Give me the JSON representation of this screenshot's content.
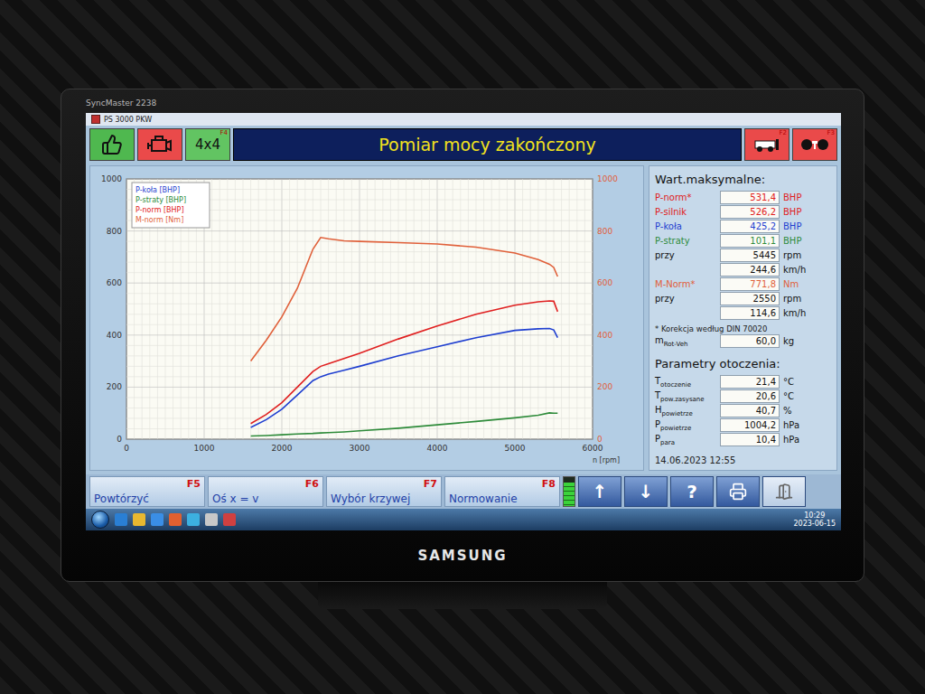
{
  "monitor": {
    "model": "SyncMaster 2238",
    "brand": "SAMSUNG"
  },
  "window": {
    "title": "PS 3000 PKW"
  },
  "header": {
    "drive": {
      "label": "4x4",
      "key": "F4"
    },
    "title": "Pomiar mocy zakończony",
    "vehicle_key": "F2",
    "roller_key": "F3"
  },
  "chart": {
    "x_label": "n [rpm]",
    "x_ticks": [
      "0",
      "1000",
      "2000",
      "3000",
      "4000",
      "5000",
      "6000"
    ],
    "y_ticks": [
      "0",
      "200",
      "400",
      "600",
      "800",
      "1000"
    ],
    "y2_ticks": [
      "0",
      "200",
      "400",
      "600",
      "800",
      "1000"
    ],
    "rpm": [
      1600,
      1800,
      2000,
      2200,
      2400,
      2500,
      2600,
      2800,
      3000,
      3500,
      4000,
      4500,
      5000,
      5300,
      5445,
      5500,
      5550
    ],
    "series": [
      {
        "name": "P-koła [BHP]",
        "color": "#1f3fd0",
        "values": [
          45,
          75,
          115,
          170,
          225,
          240,
          250,
          265,
          280,
          320,
          355,
          390,
          418,
          424,
          425.2,
          420,
          390
        ]
      },
      {
        "name": "P-straty [BHP]",
        "color": "#2e8b3a",
        "values": [
          12,
          14,
          17,
          20,
          22,
          24,
          25,
          28,
          32,
          42,
          55,
          68,
          82,
          92,
          101.1,
          100,
          100
        ]
      },
      {
        "name": "P-norm [BHP]",
        "color": "#e02020",
        "values": [
          60,
          95,
          140,
          200,
          260,
          280,
          290,
          310,
          330,
          385,
          435,
          480,
          515,
          528,
          531.4,
          530,
          490
        ]
      },
      {
        "name": "M-norm [Nm]",
        "color": "#e0603a",
        "values": [
          300,
          380,
          470,
          580,
          730,
          775,
          770,
          762,
          760,
          755,
          750,
          738,
          715,
          690,
          672,
          660,
          625
        ]
      }
    ]
  },
  "maxima": {
    "title": "Wart.maksymalne:",
    "rows": [
      {
        "label": "P-norm*",
        "value": "531,4",
        "unit": "BHP",
        "color": "#e02020"
      },
      {
        "label": "P-silnik",
        "value": "526,2",
        "unit": "BHP",
        "color": "#e02020"
      },
      {
        "label": "P-koła",
        "value": "425,2",
        "unit": "BHP",
        "color": "#1f3fd0"
      },
      {
        "label": "P-straty",
        "value": "101,1",
        "unit": "BHP",
        "color": "#2e8b3a"
      },
      {
        "label": "przy",
        "value": "5445",
        "unit": "rpm",
        "color": "#111111"
      },
      {
        "label": "",
        "value": "244,6",
        "unit": "km/h",
        "color": "#111111"
      },
      {
        "label": "M-Norm*",
        "value": "771,8",
        "unit": "Nm",
        "color": "#e0603a"
      },
      {
        "label": "przy",
        "value": "2550",
        "unit": "rpm",
        "color": "#111111"
      },
      {
        "label": "",
        "value": "114,6",
        "unit": "km/h",
        "color": "#111111"
      }
    ],
    "note": "* Korekcja według DIN 70020",
    "mass": {
      "label": "m",
      "sub": "Rot-Veh",
      "value": "60,0",
      "unit": "kg"
    }
  },
  "ambient": {
    "title": "Parametry otoczenia:",
    "rows": [
      {
        "label": "T",
        "sub": "otoczenie",
        "value": "21,4",
        "unit": "°C"
      },
      {
        "label": "T",
        "sub": "pow.zasysane",
        "value": "20,6",
        "unit": "°C"
      },
      {
        "label": "H",
        "sub": "powietrze",
        "value": "40,7",
        "unit": "%"
      },
      {
        "label": "P",
        "sub": "powietrze",
        "value": "1004,2",
        "unit": "hPa"
      },
      {
        "label": "P",
        "sub": "para",
        "value": "10,4",
        "unit": "hPa"
      }
    ]
  },
  "timestamp": "14.06.2023 12:55",
  "function_keys": [
    {
      "label": "Powtórzyć",
      "key": "F5"
    },
    {
      "label": "Oś x = v",
      "key": "F6"
    },
    {
      "label": "Wybór krzywej",
      "key": "F7"
    },
    {
      "label": "Normowanie",
      "key": "F8"
    }
  ],
  "meter": {
    "level": 0.8
  },
  "arrows": [
    "↑",
    "↓"
  ],
  "help": "?",
  "taskbar": {
    "time": "10:29",
    "date": "2023-06-15"
  }
}
